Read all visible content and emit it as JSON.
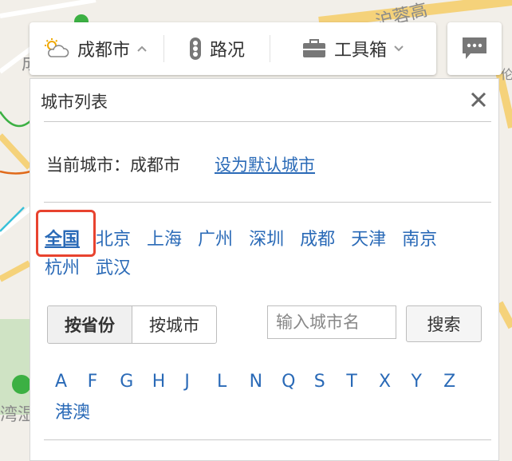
{
  "toolbar": {
    "city": "成都市",
    "traffic": "路况",
    "tools": "工具箱"
  },
  "map": {
    "road_label": "沪蓉高",
    "road_label2": "—",
    "left_label": "成",
    "left_label2": "湾湿",
    "right_label": "伦"
  },
  "panel": {
    "title": "城市列表",
    "current_city_label": "当前城市：成都市",
    "set_default": "设为默认城市",
    "quick_cities": [
      "全国",
      "北京",
      "上海",
      "广州",
      "深圳",
      "成都",
      "天津",
      "南京",
      "杭州",
      "武汉"
    ],
    "tabs": [
      "按省份",
      "按城市"
    ],
    "search_placeholder": "输入城市名",
    "search_button": "搜索",
    "letters": [
      "A",
      "F",
      "G",
      "H",
      "J",
      "L",
      "N",
      "Q",
      "S",
      "T",
      "X",
      "Y",
      "Z"
    ],
    "special_region": "港澳"
  },
  "colors": {
    "link": "#2a6ab7",
    "highlight": "#e8432f"
  }
}
